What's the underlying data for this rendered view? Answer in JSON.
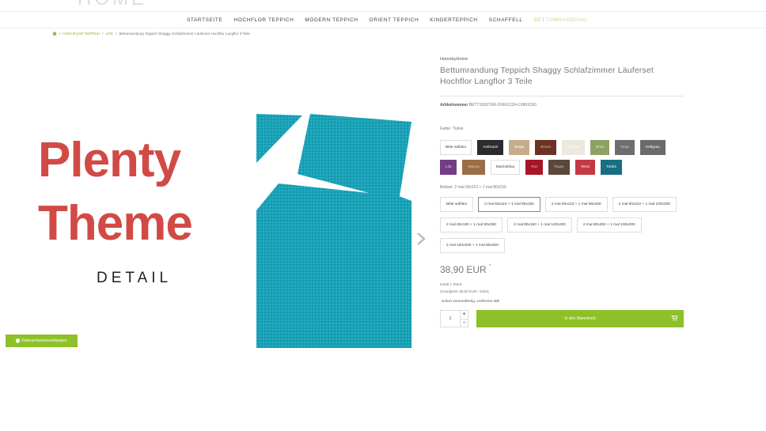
{
  "logo": {
    "text": "HOME"
  },
  "nav": {
    "items": [
      "STARTSEITE",
      "HOCHFLOR TEPPICH",
      "MODERN TEPPICH",
      "ORIENT TEPPICH",
      "KINDERTEPPICH",
      "SCHAFFELL",
      "BETTUMRANDUNG"
    ],
    "active_index": 6
  },
  "breadcrumb": {
    "items": [
      "HOCHFLOR TEPPICH",
      "LIFE",
      "Bettumrandung Teppich Shaggy Schlafzimmer Läuferset Hochflor Langflor 3 Teile"
    ]
  },
  "gallery": {
    "promo_line1": "Plenty",
    "promo_line2": "Theme",
    "promo_line3": "DETAIL",
    "rug_color": "#1aa2b8"
  },
  "product": {
    "brand": "HomebyHome",
    "title": "Bettumrandung Teppich Shaggy Schlafzimmer Läuferset Hochflor Langflor 3 Teile",
    "sku_label": "Artikelnummer",
    "sku_value": "BETT1500TUR-2X60X110+1X80X150",
    "color_label": "Farbe: Türkis",
    "colors": [
      {
        "label": "Bitte wählen",
        "bg": "#ffffff",
        "fg": "#444444"
      },
      {
        "label": "Anthrazit",
        "bg": "#2b2b2b",
        "fg": "#ffffff"
      },
      {
        "label": "Beige",
        "bg": "#c7ab8a",
        "fg": "#ffffff"
      },
      {
        "label": "Braun",
        "bg": "#6c3324",
        "fg": "#d9b9ad"
      },
      {
        "label": "Creme",
        "bg": "#ece7df",
        "fg": "#ffffff"
      },
      {
        "label": "Grün",
        "bg": "#8fa266",
        "fg": "#e2e8d2"
      },
      {
        "label": "Grau",
        "bg": "#6e6e6e",
        "fg": "#dddddd"
      },
      {
        "label": "Hellgrau",
        "bg": "#6a6a6a",
        "fg": "#ffffff"
      },
      {
        "label": "Lila",
        "bg": "#733d85",
        "fg": "#e6c8ef"
      },
      {
        "label": "Mocca",
        "bg": "#9a6e48",
        "fg": "#e5d1be"
      },
      {
        "label": "Marineblau",
        "bg": "#ffffff",
        "fg": "#444444"
      },
      {
        "label": "Rot",
        "bg": "#a51628",
        "fg": "#f2b4bc"
      },
      {
        "label": "Taupe",
        "bg": "#59483b",
        "fg": "#cdbfb3"
      },
      {
        "label": "Terra",
        "bg": "#c33a45",
        "fg": "#ffffff"
      },
      {
        "label": "Türkis",
        "bg": "#166f82",
        "fg": "#ffffff"
      }
    ],
    "set_label": "Bettset: 2 mal 60x110 + 1 mal 80x150",
    "sizes": [
      "Bitte wählen",
      "2 mal 60x110 + 1 mal 80x150",
      "2 mal 60x110 + 1 mal 80x250",
      "2 mal 60x110 + 1 mal 100x200",
      "2 mal 80x150 + 1 mal 80x250",
      "2 mal 80x150 + 1 mal 100x200",
      "2 mal 80x250 + 1 mal 100x200",
      "2 mal 100x200 + 1 mal 80x250"
    ],
    "selected_size_index": 1,
    "price": "38,90 EUR",
    "price_mark": "*",
    "content": "Inhalt 1 Stück",
    "base_price": "Grundpreis 38,90 EUR / Stück",
    "shipping": "Sofort versandfertig, Lieferzeit 48h",
    "quantity": "1",
    "add_to_cart": "In den Warenkorb"
  },
  "privacy": {
    "label": "Datenschutzeinstellungen"
  },
  "accent": "#8ec028"
}
